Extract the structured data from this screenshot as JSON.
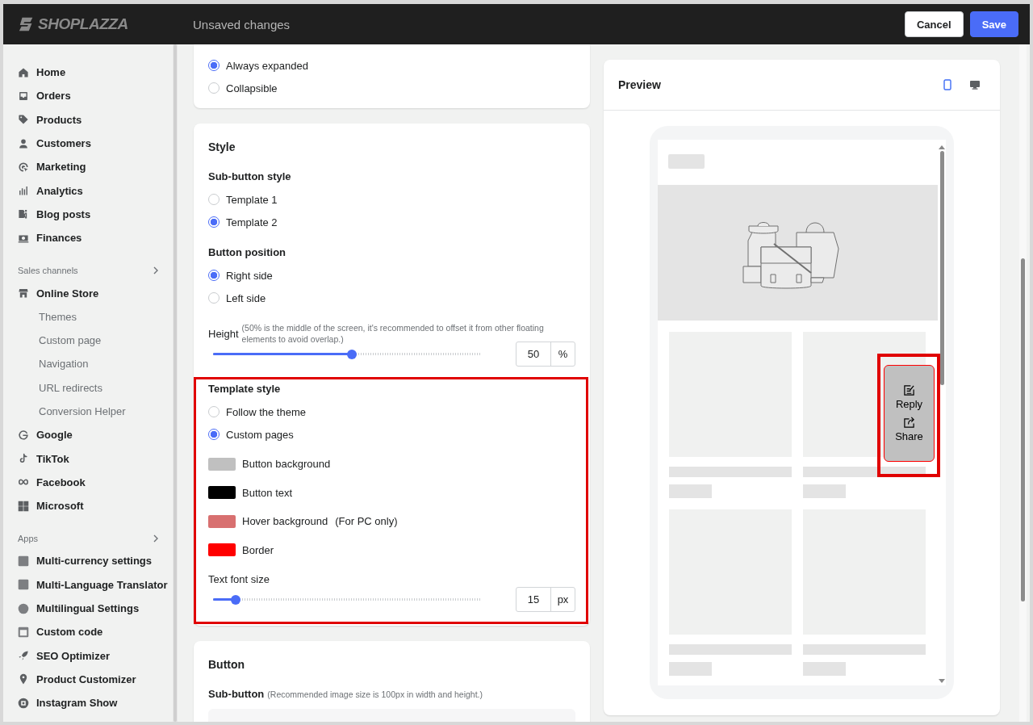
{
  "topbar": {
    "logo": "SHOPLAZZA",
    "title": "Unsaved changes",
    "buttons": [
      {
        "label": "Cancel",
        "kind": "secondary"
      },
      {
        "label": "Save",
        "kind": "primary"
      }
    ]
  },
  "sidebar": {
    "items": [
      {
        "label": "Home"
      },
      {
        "label": "Orders"
      },
      {
        "label": "Products"
      },
      {
        "label": "Customers"
      },
      {
        "label": "Marketing"
      },
      {
        "label": "Analytics"
      },
      {
        "label": "Blog posts"
      },
      {
        "label": "Finances"
      }
    ],
    "sections": [
      {
        "title": "Sales channels",
        "items": [
          {
            "label": "Online Store",
            "children": [
              {
                "label": "Themes"
              },
              {
                "label": "Custom page"
              },
              {
                "label": "Navigation"
              },
              {
                "label": "URL redirects"
              },
              {
                "label": "Conversion Helper"
              }
            ]
          },
          {
            "label": "Google"
          },
          {
            "label": "TikTok"
          },
          {
            "label": "Facebook"
          },
          {
            "label": "Microsoft"
          }
        ]
      },
      {
        "title": "Apps",
        "items": [
          {
            "label": "Multi-currency settings"
          },
          {
            "label": "Multi-Language Translator"
          },
          {
            "label": "Multilingual Settings"
          },
          {
            "label": "Custom code"
          },
          {
            "label": "SEO Optimizer"
          },
          {
            "label": "Product Customizer"
          },
          {
            "label": "Instagram Show"
          }
        ]
      }
    ]
  },
  "display": {
    "options": [
      {
        "label": "Always expanded",
        "selected": true
      },
      {
        "label": "Collapsible",
        "selected": false
      }
    ]
  },
  "style": {
    "title": "Style",
    "sub_button_style": {
      "label": "Sub-button style",
      "options": [
        {
          "label": "Template 1",
          "selected": false
        },
        {
          "label": "Template 2",
          "selected": true
        }
      ]
    },
    "button_position": {
      "label": "Button position",
      "options": [
        {
          "label": "Right side",
          "selected": true
        },
        {
          "label": "Left side",
          "selected": false
        }
      ]
    },
    "height": {
      "label": "Height",
      "hint": "(50% is the middle of the screen, it's recommended to offset it from other floating elements to avoid overlap.)",
      "level": 0.5,
      "value": "50",
      "unit": "%"
    },
    "template_style": {
      "label": "Template style",
      "highlighted": true,
      "options": [
        {
          "label": "Follow the theme",
          "selected": false
        },
        {
          "label": "Custom pages",
          "selected": true
        }
      ],
      "colors": [
        {
          "label": "Button background",
          "color": "#c0c0c0"
        },
        {
          "label": "Button text",
          "color": "#000000"
        },
        {
          "label": "Hover background",
          "note": "(For PC only)",
          "color": "#d87070"
        },
        {
          "label": "Border",
          "color": "#ff0000"
        }
      ],
      "font_size": {
        "label": "Text font size",
        "level": 0.08,
        "value": "15",
        "unit": "px"
      }
    }
  },
  "button": {
    "title": "Button",
    "sub_button": {
      "label": "Sub-button",
      "hint": "(Recommended image size is 100px in width and height.)"
    }
  },
  "preview": {
    "title": "Preview",
    "devices": [
      {
        "kind": "mobile",
        "selected": true
      },
      {
        "kind": "desktop",
        "selected": false
      }
    ],
    "floating": {
      "highlighted": true,
      "buttons": [
        {
          "label": "Reply",
          "kind": "reply"
        },
        {
          "label": "Share",
          "kind": "share"
        }
      ]
    }
  }
}
